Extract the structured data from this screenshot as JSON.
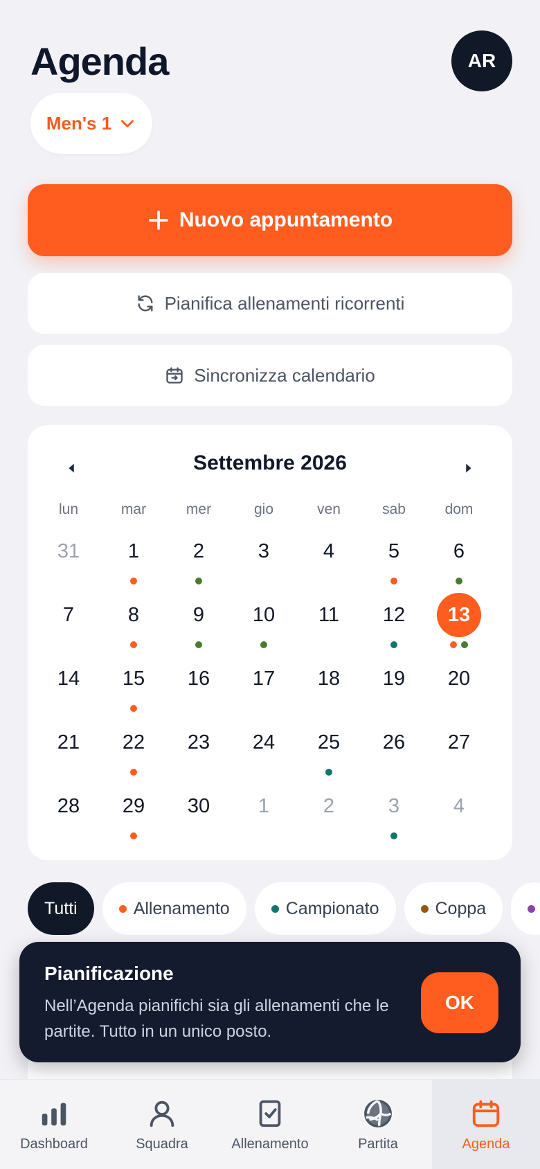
{
  "header": {
    "title": "Agenda",
    "avatar_initials": "AR"
  },
  "team_select": {
    "value": "Men's 1"
  },
  "actions": {
    "new_appointment": "Nuovo appuntamento",
    "recurring": "Pianifica allenamenti ricorrenti",
    "sync": "Sincronizza calendario"
  },
  "calendar": {
    "month": "Settembre 2026",
    "weekdays": [
      "lun",
      "mar",
      "mer",
      "gio",
      "ven",
      "sab",
      "dom"
    ],
    "selected_day": 13,
    "days": [
      {
        "n": "31",
        "muted": true,
        "dots": []
      },
      {
        "n": "1",
        "dots": [
          "training"
        ]
      },
      {
        "n": "2",
        "dots": [
          "green"
        ]
      },
      {
        "n": "3",
        "dots": []
      },
      {
        "n": "4",
        "dots": []
      },
      {
        "n": "5",
        "dots": [
          "training"
        ]
      },
      {
        "n": "6",
        "dots": [
          "green"
        ]
      },
      {
        "n": "7",
        "dots": []
      },
      {
        "n": "8",
        "dots": [
          "training"
        ]
      },
      {
        "n": "9",
        "dots": [
          "green"
        ]
      },
      {
        "n": "10",
        "dots": [
          "green"
        ]
      },
      {
        "n": "11",
        "dots": []
      },
      {
        "n": "12",
        "dots": [
          "championship"
        ]
      },
      {
        "n": "13",
        "selected": true,
        "dots": [
          "training",
          "green"
        ]
      },
      {
        "n": "14",
        "dots": []
      },
      {
        "n": "15",
        "dots": [
          "training"
        ]
      },
      {
        "n": "16",
        "dots": []
      },
      {
        "n": "17",
        "dots": []
      },
      {
        "n": "18",
        "dots": []
      },
      {
        "n": "19",
        "dots": []
      },
      {
        "n": "20",
        "dots": []
      },
      {
        "n": "21",
        "dots": []
      },
      {
        "n": "22",
        "dots": [
          "training"
        ]
      },
      {
        "n": "23",
        "dots": []
      },
      {
        "n": "24",
        "dots": []
      },
      {
        "n": "25",
        "dots": [
          "championship"
        ]
      },
      {
        "n": "26",
        "dots": []
      },
      {
        "n": "27",
        "dots": []
      },
      {
        "n": "28",
        "dots": []
      },
      {
        "n": "29",
        "dots": [
          "training"
        ]
      },
      {
        "n": "30",
        "dots": []
      },
      {
        "n": "1",
        "muted": true,
        "dots": []
      },
      {
        "n": "2",
        "muted": true,
        "dots": []
      },
      {
        "n": "3",
        "muted": true,
        "dots": [
          "championship"
        ]
      },
      {
        "n": "4",
        "muted": true,
        "dots": []
      }
    ]
  },
  "filters": [
    {
      "label": "Tutti",
      "active": true,
      "color": ""
    },
    {
      "label": "Allenamento",
      "color": "#ff5c1f"
    },
    {
      "label": "Campionato",
      "color": "#0f766e"
    },
    {
      "label": "Coppa",
      "color": "#92590e"
    },
    {
      "label": "",
      "color": "#8e44ad"
    }
  ],
  "colors": {
    "accent": "#ff5c1f",
    "training": "#ff5c1f",
    "green": "#4a7a32",
    "championship": "#0f766e",
    "cup": "#92590e",
    "dark": "#111827"
  },
  "toast": {
    "title": "Pianificazione",
    "text": "Nell’Agenda pianifichi sia gli allenamenti che le partite. Tutto in un unico posto.",
    "ok": "OK"
  },
  "nav": {
    "items": [
      {
        "label": "Dashboard",
        "icon": "bar-chart-icon"
      },
      {
        "label": "Squadra",
        "icon": "user-icon"
      },
      {
        "label": "Allenamento",
        "icon": "clipboard-check-icon"
      },
      {
        "label": "Partita",
        "icon": "volleyball-icon"
      },
      {
        "label": "Agenda",
        "icon": "calendar-icon",
        "active": true
      }
    ]
  }
}
